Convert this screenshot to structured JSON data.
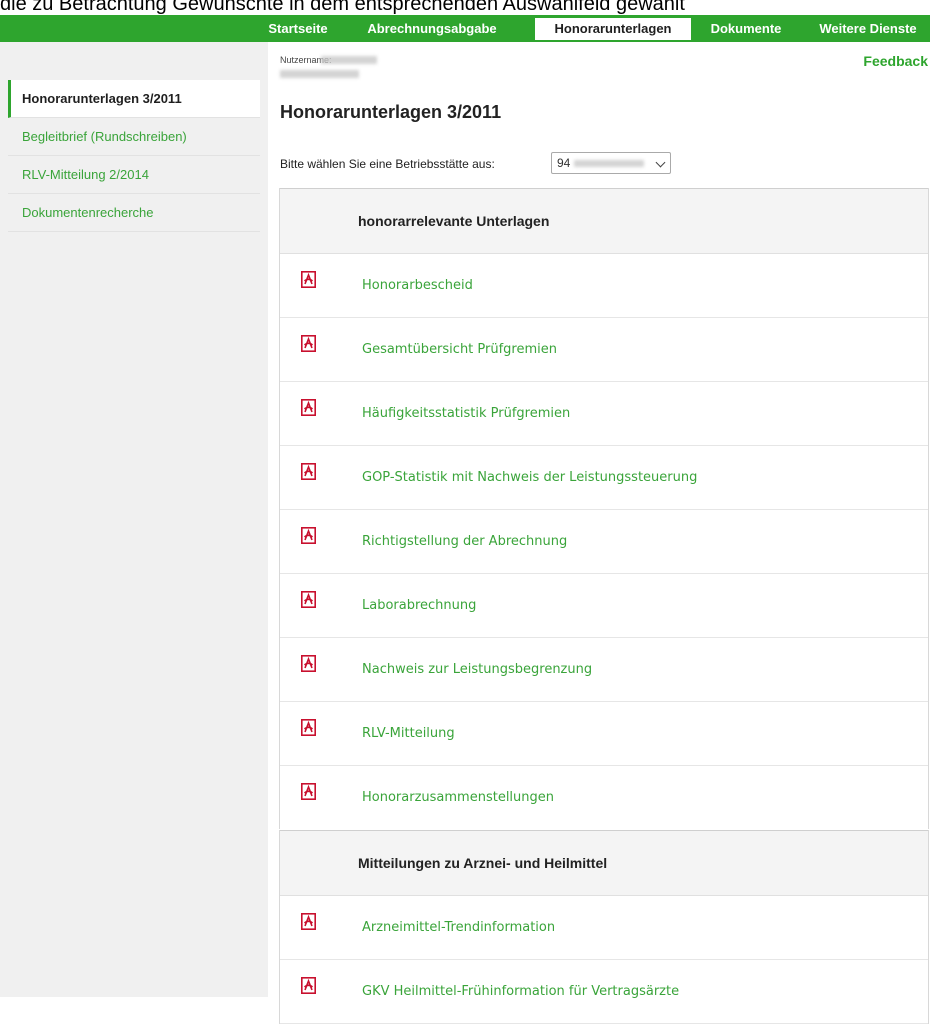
{
  "doc_text_above": "die zu Betrachtung Gewünschte in dem entsprechenden Auswahlfeld gewählt",
  "topnav": {
    "items": [
      {
        "label": "Startseite"
      },
      {
        "label": "Abrechnungsabgabe"
      },
      {
        "label": "Honorarunterlagen"
      },
      {
        "label": "Dokumente"
      },
      {
        "label": "Weitere Dienste"
      }
    ],
    "active": "Honorarunterlagen"
  },
  "sidebar": {
    "items": [
      {
        "label": "Honorarunterlagen 3/2011"
      },
      {
        "label": "Begleitbrief (Rundschreiben)"
      },
      {
        "label": "RLV-Mitteilung 2/2014"
      },
      {
        "label": "Dokumentenrecherche"
      }
    ],
    "active": "Honorarunterlagen 3/2011"
  },
  "header": {
    "user_label": "Nutzername:",
    "feedback": "Feedback"
  },
  "main": {
    "title": "Honorarunterlagen 3/2011",
    "select_label": "Bitte wählen Sie eine Betriebsstätte aus:",
    "select_value": "94"
  },
  "sections": [
    {
      "title": "honorarrelevante Unterlagen",
      "documents": [
        {
          "label": "Honorarbescheid"
        },
        {
          "label": "Gesamtübersicht Prüfgremien"
        },
        {
          "label": "Häufigkeitsstatistik Prüfgremien"
        },
        {
          "label": "GOP-Statistik mit Nachweis der Leistungssteuerung"
        },
        {
          "label": "Richtigstellung der Abrechnung"
        },
        {
          "label": "Laborabrechnung"
        },
        {
          "label": "Nachweis zur Leistungsbegrenzung"
        },
        {
          "label": "RLV-Mitteilung"
        },
        {
          "label": "Honorarzusammenstellungen"
        }
      ]
    },
    {
      "title": "Mitteilungen zu Arznei- und Heilmittel",
      "documents": [
        {
          "label": "Arzneimittel-Trendinformation"
        },
        {
          "label": "GKV Heilmittel-Frühinformation für Vertragsärzte"
        }
      ]
    }
  ],
  "icons": {
    "document": "pdf-icon"
  },
  "colors": {
    "accent": "#2ea52e",
    "link": "#3aa43a",
    "pdf_icon": "#c8102e",
    "sidebar_bg": "#f0f0f0"
  }
}
